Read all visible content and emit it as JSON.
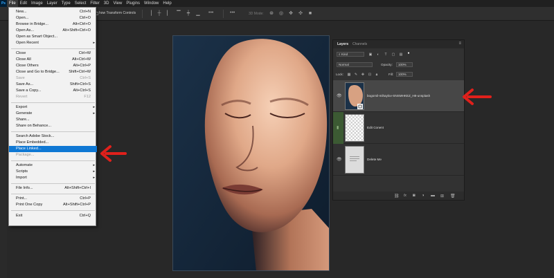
{
  "menubar": {
    "logo": "Ps",
    "items": [
      "File",
      "Edit",
      "Image",
      "Layer",
      "Type",
      "Select",
      "Filter",
      "3D",
      "View",
      "Plugins",
      "Window",
      "Help"
    ]
  },
  "options_bar": {
    "transform_label": "how Transform Controls",
    "mode_3d": "3D Mode:",
    "more_glyph": "•••"
  },
  "file_menu": {
    "items": [
      {
        "label": "New...",
        "shortcut": "Ctrl+N"
      },
      {
        "label": "Open...",
        "shortcut": "Ctrl+O"
      },
      {
        "label": "Browse in Bridge...",
        "shortcut": "Alt+Ctrl+O"
      },
      {
        "label": "Open As...",
        "shortcut": "Alt+Shift+Ctrl+O"
      },
      {
        "label": "Open as Smart Object...",
        "shortcut": ""
      },
      {
        "label": "Open Recent",
        "shortcut": ""
      },
      {
        "label": "Close",
        "shortcut": "Ctrl+W"
      },
      {
        "label": "Close All",
        "shortcut": "Alt+Ctrl+W"
      },
      {
        "label": "Close Others",
        "shortcut": "Alt+Ctrl+P"
      },
      {
        "label": "Close and Go to Bridge...",
        "shortcut": "Shift+Ctrl+W"
      },
      {
        "label": "Save",
        "shortcut": "Ctrl+S"
      },
      {
        "label": "Save As...",
        "shortcut": "Shift+Ctrl+S"
      },
      {
        "label": "Save a Copy...",
        "shortcut": "Alt+Ctrl+S"
      },
      {
        "label": "Revert",
        "shortcut": "F12"
      },
      {
        "label": "Export",
        "shortcut": ""
      },
      {
        "label": "Generate",
        "shortcut": ""
      },
      {
        "label": "Share...",
        "shortcut": ""
      },
      {
        "label": "Share on Behance...",
        "shortcut": ""
      },
      {
        "label": "Search Adobe Stock...",
        "shortcut": ""
      },
      {
        "label": "Place Embedded...",
        "shortcut": ""
      },
      {
        "label": "Place Linked...",
        "shortcut": ""
      },
      {
        "label": "Package...",
        "shortcut": ""
      },
      {
        "label": "Automate",
        "shortcut": ""
      },
      {
        "label": "Scripts",
        "shortcut": ""
      },
      {
        "label": "Import",
        "shortcut": ""
      },
      {
        "label": "File Info...",
        "shortcut": "Alt+Shift+Ctrl+I"
      },
      {
        "label": "Print...",
        "shortcut": "Ctrl+P"
      },
      {
        "label": "Print One Copy",
        "shortcut": "Alt+Shift+Ctrl+P"
      },
      {
        "label": "Exit",
        "shortcut": "Ctrl+Q"
      }
    ],
    "submenu_glyph": "▸"
  },
  "layers_panel": {
    "tabs": [
      "Layers",
      "Channels"
    ],
    "menu_glyph": "≡",
    "filter_kind": "Kind",
    "blend_mode": "Normal",
    "opacity_label": "Opacity:",
    "opacity_value": "100%",
    "lock_label": "Lock:",
    "fill_label": "Fill:",
    "fill_value": "100%",
    "layers": [
      {
        "name": "bogomil-mihaylov-SNSMHKEZ_H8-unsplash",
        "selected": true
      },
      {
        "name": "Edit Conent",
        "selected": false
      },
      {
        "name": "Delete Me",
        "selected": false
      }
    ],
    "bottom_icons": [
      "link-icon",
      "fx-icon",
      "mask-icon",
      "adjustment-icon",
      "folder-icon",
      "new-layer-icon",
      "trash-icon"
    ]
  },
  "colors": {
    "highlight": "#0f78d4",
    "annotation_arrow": "#e0201b",
    "panel_bg": "#323232"
  }
}
